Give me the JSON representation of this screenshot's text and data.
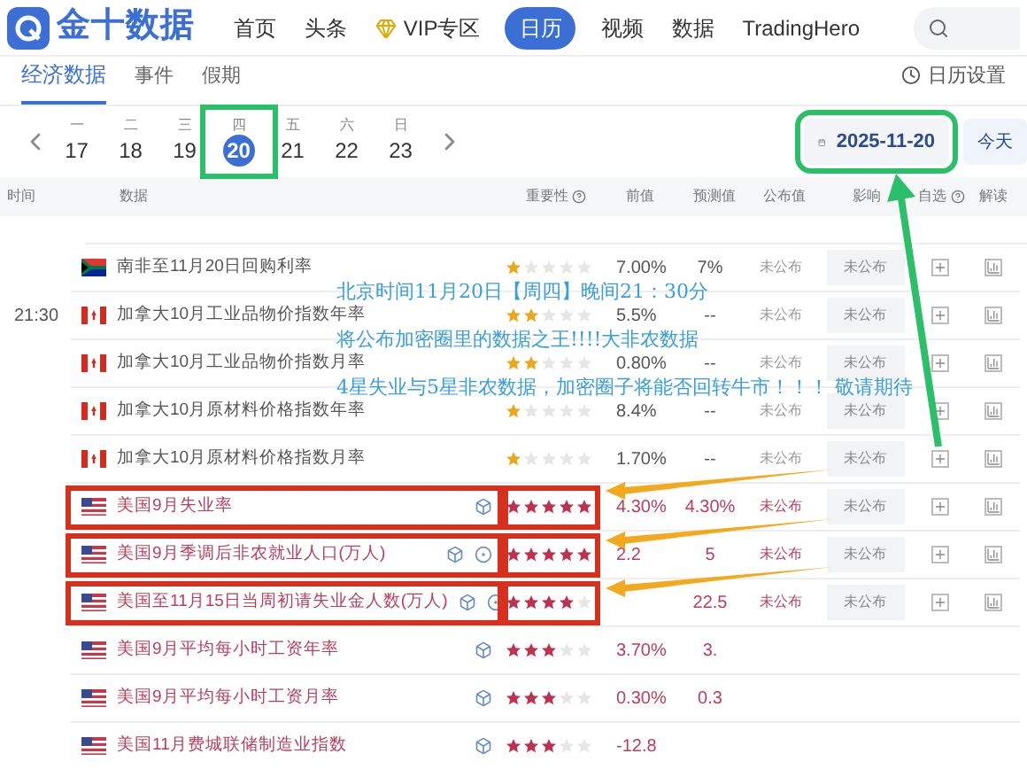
{
  "nav": {
    "logo": "金十数据",
    "items": [
      {
        "label": "首页",
        "selected": false,
        "kind": "plain"
      },
      {
        "label": "头条",
        "selected": false,
        "kind": "plain"
      },
      {
        "label": "VIP专区",
        "selected": false,
        "kind": "vip"
      },
      {
        "label": "日历",
        "selected": true,
        "kind": "plain"
      },
      {
        "label": "视频",
        "selected": false,
        "kind": "plain"
      },
      {
        "label": "数据",
        "selected": false,
        "kind": "plain"
      },
      {
        "label": "TradingHero",
        "selected": false,
        "kind": "plain"
      }
    ]
  },
  "subtabs": [
    {
      "label": "经济数据",
      "selected": true
    },
    {
      "label": "事件",
      "selected": false
    },
    {
      "label": "假期",
      "selected": false
    }
  ],
  "settings": "日历设置",
  "days": [
    {
      "weekday": "一",
      "day": "17",
      "selected": false
    },
    {
      "weekday": "二",
      "day": "18",
      "selected": false
    },
    {
      "weekday": "三",
      "day": "19",
      "selected": false
    },
    {
      "weekday": "四",
      "day": "20",
      "selected": true
    },
    {
      "weekday": "五",
      "day": "21",
      "selected": false
    },
    {
      "weekday": "六",
      "day": "22",
      "selected": false
    },
    {
      "weekday": "日",
      "day": "23",
      "selected": false
    }
  ],
  "date": "2025-11-20",
  "today": "今天",
  "columns": [
    "时间",
    "数据",
    "重要性",
    "前值",
    "预测值",
    "公布值",
    "影响",
    "自选",
    "解读"
  ],
  "rows": [
    {
      "kind": "za",
      "name": "南非至11月20日回购利率",
      "icons": [],
      "stars": 1,
      "previous": "7.00%",
      "forecast": "7%",
      "actual": "未公布",
      "impact": "未公布",
      "highlighted": false
    },
    {
      "time": "21:30",
      "kind": "ca",
      "name": "加拿大10月工业品物价指数年率",
      "icons": [],
      "stars": 2,
      "previous": "5.5%",
      "forecast": "--",
      "actual": "未公布",
      "impact": "未公布",
      "highlighted": false
    },
    {
      "kind": "ca",
      "name": "加拿大10月工业品物价指数月率",
      "icons": [],
      "stars": 2,
      "previous": "0.80%",
      "forecast": "--",
      "actual": "未公布",
      "impact": "未公布",
      "highlighted": false
    },
    {
      "kind": "ca",
      "name": "加拿大10月原材料价格指数年率",
      "icons": [],
      "stars": 1,
      "previous": "8.4%",
      "forecast": "--",
      "actual": "未公布",
      "impact": "未公布",
      "highlighted": false
    },
    {
      "kind": "ca",
      "name": "加拿大10月原材料价格指数月率",
      "icons": [],
      "stars": 1,
      "previous": "1.70%",
      "forecast": "--",
      "actual": "未公布",
      "impact": "未公布",
      "highlighted": false
    },
    {
      "kind": "us",
      "name": "美国9月失业率",
      "icons": [
        {
          "kind": "cube"
        }
      ],
      "stars": 5,
      "previous": "4.30%",
      "forecast": "4.30%",
      "actual": "未公布",
      "impact": "未公布",
      "highlighted": true
    },
    {
      "kind": "us",
      "name": "美国9月季调后非农就业人口(万人)",
      "icons": [
        {
          "kind": "cube"
        },
        {
          "kind": "target"
        }
      ],
      "stars": 5,
      "previous": "2.2",
      "forecast": "5",
      "actual": "未公布",
      "impact": "未公布",
      "highlighted": true
    },
    {
      "kind": "us",
      "name": "美国至11月15日当周初请失业金人数(万人)",
      "icons": [
        {
          "kind": "cube"
        },
        {
          "kind": "target"
        }
      ],
      "stars": 4,
      "forecast": "22.5",
      "actual": "未公布",
      "impact": "未公布",
      "highlighted": true
    },
    {
      "kind": "us",
      "name": "美国9月平均每小时工资年率",
      "icons": [
        {
          "kind": "cube"
        }
      ],
      "stars": 3,
      "previous": "3.70%",
      "forecast": "3.",
      "highlighted": false
    },
    {
      "kind": "us",
      "name": "美国9月平均每小时工资月率",
      "icons": [
        {
          "kind": "cube"
        }
      ],
      "stars": 3,
      "previous": "0.30%",
      "forecast": "0.3",
      "highlighted": false
    },
    {
      "kind": "us",
      "name": "美国11月费城联储制造业指数",
      "icons": [
        {
          "kind": "cube"
        }
      ],
      "stars": 3,
      "previous": "-12.8",
      "highlighted": false
    }
  ],
  "annotations": [
    "北京时间11月20日【周四】晚间21：30分",
    "将公布加密圈里的数据之王!!!!大非农数据",
    "4星失业与5星非农数据，加密圈子将能否回转牛市！！！ 敬请期待"
  ]
}
